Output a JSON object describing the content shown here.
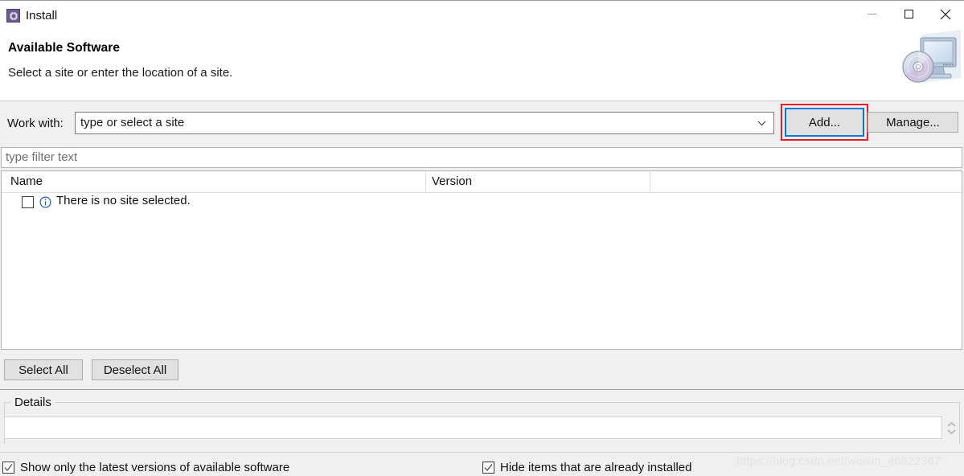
{
  "window": {
    "title": "Install",
    "icon": "install-gear-icon",
    "controls": {
      "minimize": "minimize-icon",
      "maximize": "maximize-icon",
      "close": "close-icon"
    }
  },
  "header": {
    "title": "Available Software",
    "subtitle": "Select a site or enter the location of a site.",
    "banner_icon": "computer-disc-icon"
  },
  "work_with": {
    "label": "Work with:",
    "value": "type or select a site",
    "placeholder": "type or select a site",
    "dropdown_icon": "chevron-down-icon",
    "add_label": "Add...",
    "manage_label": "Manage..."
  },
  "filter": {
    "placeholder": "type filter text",
    "value": ""
  },
  "table": {
    "columns": [
      "Name",
      "Version"
    ],
    "rows": [
      {
        "checked": false,
        "icon": "info-icon",
        "name": "There is no site selected.",
        "version": ""
      }
    ]
  },
  "selection_buttons": {
    "select_all": "Select All",
    "deselect_all": "Deselect All"
  },
  "details": {
    "legend": "Details",
    "value": "",
    "scroll_icon": "scroll-up-down-icon"
  },
  "options": [
    {
      "label": "Show only the latest versions of available software",
      "checked": true
    },
    {
      "label": "Hide items that are already installed",
      "checked": true
    }
  ],
  "watermark": "https://blog.csdn.net/weixin_46822367",
  "colors": {
    "dialog_bg": "#f0f0f0",
    "focus_blue": "#0078d7",
    "annotation_red": "#ed1c24",
    "info_blue": "#1f5fa9"
  }
}
